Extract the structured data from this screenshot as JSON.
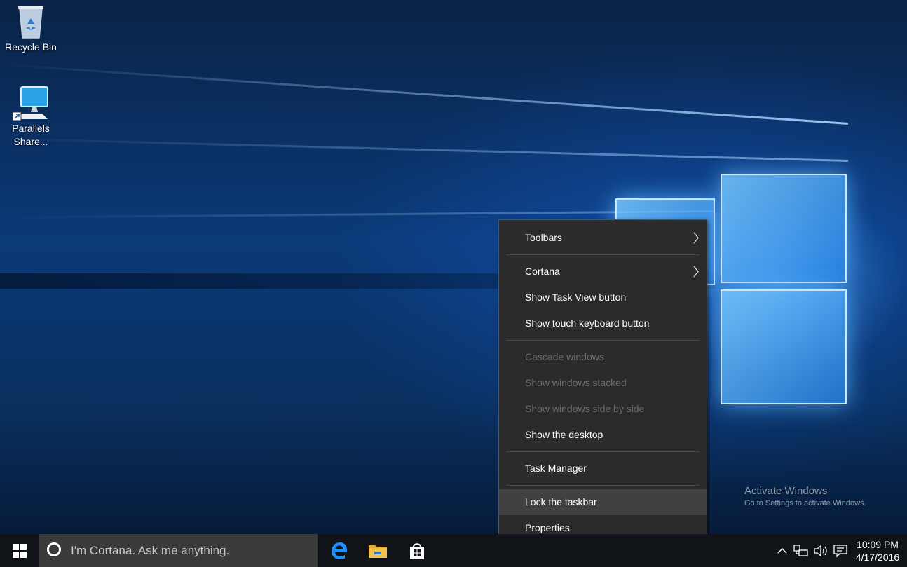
{
  "desktop_icons": [
    {
      "label": "Recycle Bin",
      "icon": "recycle-bin-icon"
    },
    {
      "label": "Parallels Share...",
      "icon": "parallels-shared-computer-icon"
    }
  ],
  "watermark": {
    "title": "Activate Windows",
    "subtitle": "Go to Settings to activate Windows."
  },
  "context_menu": {
    "items": [
      {
        "label": "Toolbars",
        "submenu": true,
        "enabled": true
      },
      {
        "label": "Cortana",
        "submenu": true,
        "enabled": true
      },
      {
        "label": "Show Task View button",
        "enabled": true
      },
      {
        "label": "Show touch keyboard button",
        "enabled": true
      },
      {
        "label": "Cascade windows",
        "enabled": false
      },
      {
        "label": "Show windows stacked",
        "enabled": false
      },
      {
        "label": "Show windows side by side",
        "enabled": false
      },
      {
        "label": "Show the desktop",
        "enabled": true
      },
      {
        "label": "Task Manager",
        "enabled": true
      },
      {
        "label": "Lock the taskbar",
        "enabled": true,
        "highlighted": true
      },
      {
        "label": "Properties",
        "enabled": true
      }
    ],
    "arrow_glyph": "›"
  },
  "taskbar": {
    "search_placeholder": "I'm Cortana. Ask me anything.",
    "pinned_apps": [
      "edge-icon",
      "file-explorer-icon",
      "store-icon"
    ],
    "tray_icons": [
      "show-hidden-icons-chevron-icon",
      "network-icon",
      "volume-icon",
      "action-center-icon"
    ],
    "time": "10:09 PM",
    "date": "4/17/2016"
  },
  "colors": {
    "taskbar": "#101418",
    "search_box": "#3a3a3a",
    "menu_bg": "#2b2b2b",
    "menu_highlight": "#414141",
    "disabled_text": "#6d6d6d",
    "edge_blue": "#1e90ff",
    "folder_yellow": "#f2c14e"
  }
}
